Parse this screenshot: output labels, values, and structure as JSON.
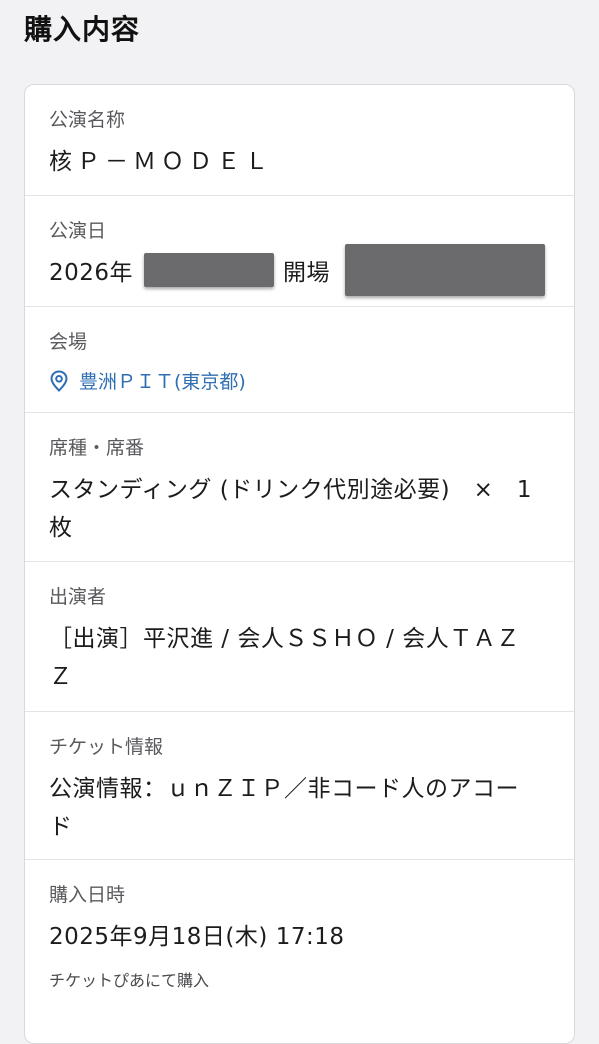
{
  "page": {
    "title": "購入内容"
  },
  "purchase": {
    "event_name": {
      "label": "公演名称",
      "value": "核Ｐ－ＭＯＤＥＬ"
    },
    "event_date": {
      "label": "公演日",
      "date_prefix": "2026年",
      "doors_label": "開場"
    },
    "venue": {
      "label": "会場",
      "value": "豊洲ＰＩＴ(東京都)",
      "icon": "map-pin-icon",
      "link_color": "#2f6fb2"
    },
    "seat": {
      "label": "席種・席番",
      "value_line1": "スタンディング (ドリンク代別途必要)　×　1",
      "value_line2": "枚"
    },
    "performers": {
      "label": "出演者",
      "value_line1": "［出演］平沢進 / 会人ＳＳＨＯ / 会人ＴＡＺ",
      "value_line2": "Ｚ"
    },
    "ticket_info": {
      "label": "チケット情報",
      "value_line1": "公演情報：ｕｎＺＩＰ／非コード人のアコー",
      "value_line2": "ド"
    },
    "purchase_datetime": {
      "label": "購入日時",
      "value": "2025年9月18日(木) 17:18",
      "note": "チケットぴあにて購入"
    }
  }
}
